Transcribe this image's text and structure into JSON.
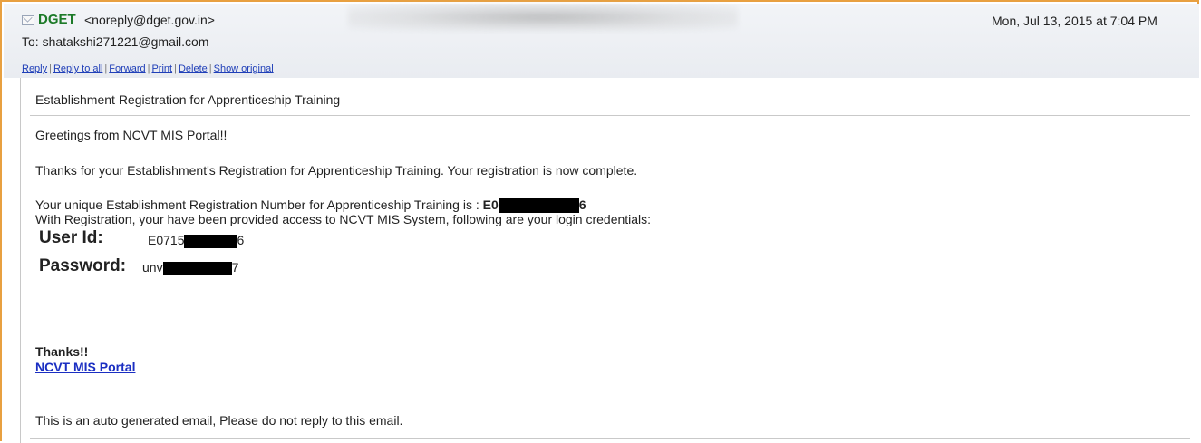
{
  "header": {
    "sender_name": "DGET",
    "sender_email": "<noreply@dget.gov.in>",
    "date": "Mon, Jul 13, 2015 at 7:04 PM",
    "to": "To: shatakshi271221@gmail.com"
  },
  "actions": {
    "reply": "Reply",
    "reply_all": "Reply to all",
    "forward": "Forward",
    "print": "Print",
    "delete": "Delete",
    "show_original": "Show original",
    "separator": "|"
  },
  "email": {
    "subject": "Establishment Registration for Apprenticeship Training",
    "greeting": "Greetings from NCVT MIS Portal!!",
    "thanks_line": "Thanks for your Establishment's Registration for Apprenticeship Training. Your registration is now complete.",
    "reg_prefix": "Your unique Establishment Registration Number for Apprenticeship Training is : ",
    "reg_visible_start": "E0",
    "reg_visible_end": "6",
    "access_line": "With Registration, your have been provided access to NCVT MIS System, following are your login credentials:",
    "user_id_label": "User Id:",
    "user_id_start": "E0715",
    "user_id_end": "6",
    "password_label": "Password:",
    "password_start": "unv",
    "password_end": "7",
    "signoff": "Thanks!!",
    "portal_link": "NCVT MIS Portal",
    "footer": "This is an auto generated email, Please do not reply to this email."
  },
  "colors": {
    "border_accent": "#e8a040",
    "sender": "#1c7a28",
    "link": "#1a2ec2",
    "redaction": "#000000"
  },
  "icons": {
    "mail": "envelope-icon"
  }
}
